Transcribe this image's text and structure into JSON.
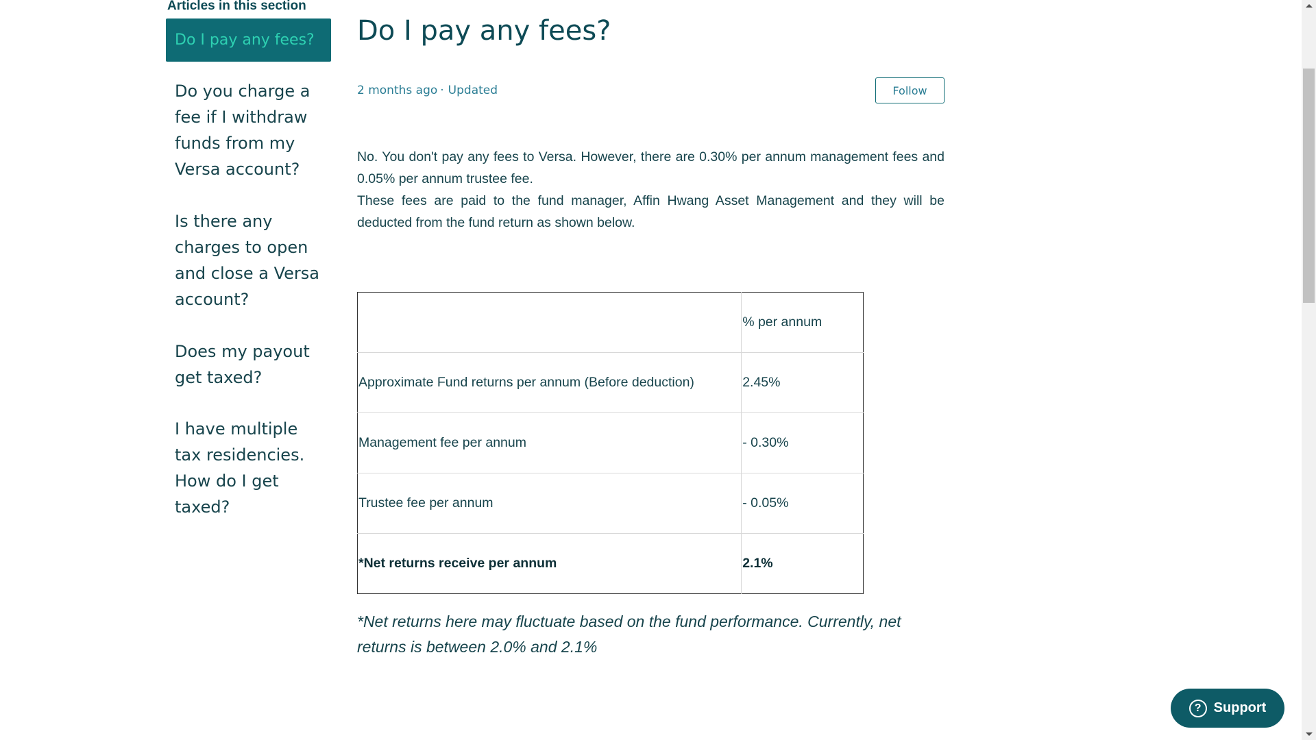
{
  "sidebar": {
    "heading": "Articles in this section",
    "items": [
      {
        "label": "Do I pay any fees?",
        "active": true
      },
      {
        "label": "Do you charge a fee if I withdraw funds from my Versa account?"
      },
      {
        "label": "Is there any charges to open and close a Versa account?"
      },
      {
        "label": "Does my payout get taxed?"
      },
      {
        "label": "I have multiple tax residencies. How do I get taxed?"
      }
    ]
  },
  "article": {
    "title": "Do I pay any fees?",
    "meta": {
      "time": "2 months ago",
      "separator": "·",
      "status": "Updated"
    },
    "follow_label": "Follow",
    "body": [
      "No. You don't pay any fees to Versa. However, there are 0.30% per annum management fees and 0.05% per annum trustee fee.",
      "These fees are paid to the fund manager, Affin Hwang Asset Management and they will be deducted from the fund return as shown below."
    ],
    "table": {
      "header": [
        "",
        "% per annum"
      ],
      "rows": [
        [
          "Approximate Fund returns per annum (Before deduction)",
          "2.45%"
        ],
        [
          "Management fee per annum",
          "- 0.30%"
        ],
        [
          "Trustee fee per annum",
          "- 0.05%"
        ],
        [
          "*Net returns receive per annum",
          "2.1%"
        ]
      ]
    },
    "note": "*Net returns here may fluctuate based on the fund performance. Currently, net returns is between 2.0% and 2.1%"
  },
  "support": {
    "label": "Support",
    "icon": "help-circle-icon",
    "icon_glyph": "?"
  },
  "colors": {
    "accent": "#0e6b74",
    "active_text": "#2ed1b2",
    "support_bg": "#0e5b66",
    "text": "#17444c"
  }
}
